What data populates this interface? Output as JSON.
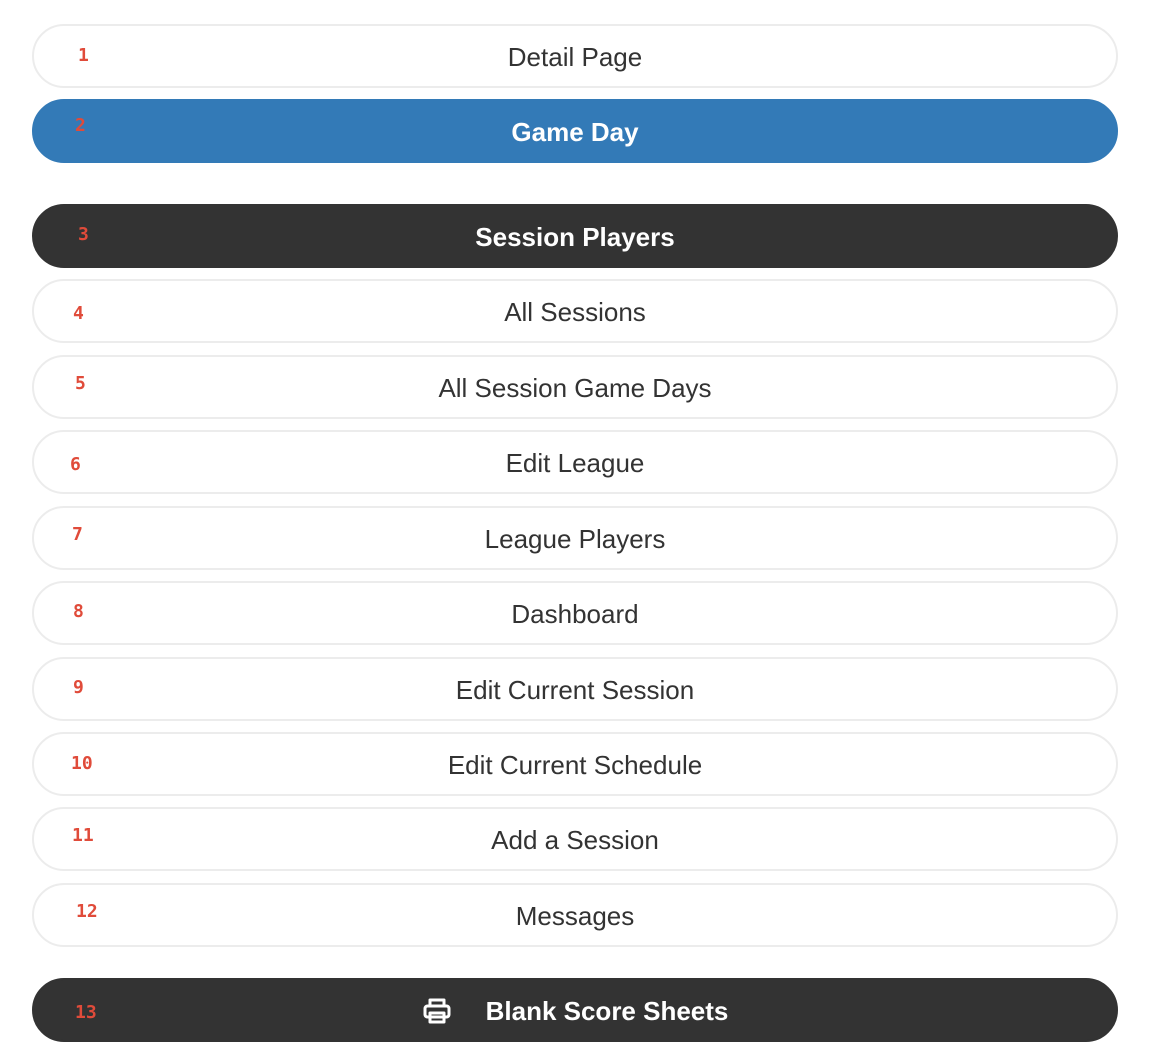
{
  "menu": {
    "items": [
      {
        "label": "Detail Page"
      },
      {
        "label": "Game Day"
      },
      {
        "label": "Session Players"
      },
      {
        "label": "All Sessions"
      },
      {
        "label": "All Session Game Days"
      },
      {
        "label": "Edit League"
      },
      {
        "label": "League Players"
      },
      {
        "label": "Dashboard"
      },
      {
        "label": "Edit Current Session"
      },
      {
        "label": "Edit Current Schedule"
      },
      {
        "label": "Add a Session"
      },
      {
        "label": "Messages"
      },
      {
        "label": "Blank Score Sheets",
        "icon": "print-icon"
      }
    ]
  },
  "markers": [
    "1",
    "2",
    "3",
    "4",
    "5",
    "6",
    "7",
    "8",
    "9",
    "10",
    "11",
    "12",
    "13"
  ],
  "colors": {
    "primary": "#337ab7",
    "dark": "#333333",
    "border": "#ececec",
    "marker": "#e04b3a"
  }
}
